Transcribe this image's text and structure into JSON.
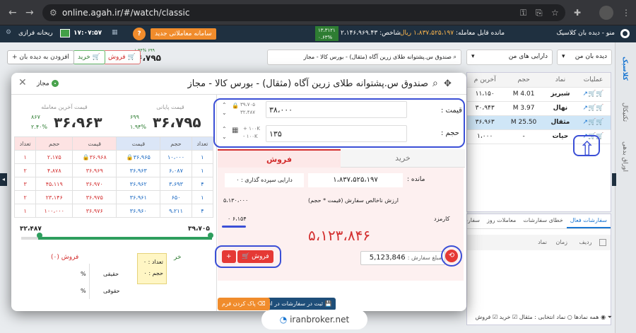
{
  "browser": {
    "url": "online.agah.ir/#/watch/classic"
  },
  "topbar": {
    "logo_label": "منو - دیده بان کلاسیک",
    "purchasable_label": "مانده قابل معامله:",
    "purchasable_value": "۱،۸۳۷،۵۲۵،۱۹۷ ریال",
    "index_label": "شاخص:",
    "index_value": "۲،۱۴۶،۹۶۹.۴۳",
    "index_change": "۱۳،۳۱۲۱",
    "index_pct": "۰.۶۳%",
    "new_system_label": "سامانه معاملاتی جدید",
    "clock": "۱۷:۰۷:۵۷",
    "calc_label": "ریحانه فرازی"
  },
  "watch": {
    "dropdown_watch": "دیده بان من",
    "dropdown_assets": "دارایی های من",
    "search_text": "صندوق س.پشتوانه طلای زرین آگاه (مثقال) - بورس کالا - مجاز",
    "add_label": "افزودن به دیده بان",
    "buy_label": "خرید",
    "sell_label": "فروش",
    "price": "۳۶،۷۹۵",
    "price_change": "۶۹۹",
    "price_pct": "۱.۹۴%",
    "col_ops": "عملیات",
    "col_symbol": "نماد",
    "col_volume": "حجم",
    "col_last": "آخرین م",
    "rows": [
      {
        "symbol": "شبریز",
        "volume": "4.01 M",
        "last": "۱۱،۱۵۰"
      },
      {
        "symbol": "نهال",
        "volume": "3.97 M",
        "last": "۳۰،۹۴۳"
      },
      {
        "symbol": "مثقال",
        "volume": "25.50 M",
        "last": "۳۶،۹۶۳"
      },
      {
        "symbol": "حیات",
        "volume": "-",
        "last": "۱،۰۰۰"
      }
    ]
  },
  "modal": {
    "title": "صندوق س.پشتوانه طلای زرین آگاه (مثقال) - بورس کالا - مجاز",
    "status": "مجاز",
    "closing_label": "قیمت پایانی",
    "closing_price": "۳۶،۷۹۵",
    "closing_change": "۶۹۹",
    "closing_pct": "۱.۹۴%",
    "last_label": "قیمت آخرین معامله",
    "last_price": "۳۶،۹۶۳",
    "last_change": "۸۶۷",
    "last_pct": "۲.۴۰%",
    "ob_headers": [
      "تعداد",
      "حجم",
      "قیمت",
      "قیمت",
      "حجم",
      "تعداد"
    ],
    "ob_rows": [
      [
        "۱",
        "۱۰،۰۰۰",
        "۳۶،۹۶۵",
        "۳۶،۹۶۸",
        "۲،۱۷۵",
        "۱"
      ],
      [
        "۱",
        "۶،۰۸۷",
        "۳۶،۹۶۳",
        "۳۶،۹۶۹",
        "۴،۸۷۸",
        "۲"
      ],
      [
        "۴",
        "۳،۶۹۳",
        "۳۶،۹۶۲",
        "۳۶،۹۷۰",
        "۴۵،۱۱۹",
        "۳"
      ],
      [
        "۱",
        "۶۵۰",
        "۳۶،۹۶۱",
        "۳۶،۹۷۵",
        "۲۳،۱۴۶",
        "۲"
      ],
      [
        "۴",
        "۹،۲۱۱",
        "۳۶،۹۶۰",
        "۳۶،۹۷۶",
        "۱۰۰،۰۰۰",
        "۱"
      ]
    ],
    "range_low": "۳۲،۴۸۷",
    "range_high": "۳۹،۷۰۵",
    "range_fill": 1.0,
    "sell_label": "فروش (۰)",
    "buy_label": "خر",
    "tooltip_count": "تعداد : ۰",
    "tooltip_volume": "حجم : ۰",
    "real_label": "حقیقی",
    "legal_label": "حقوقی",
    "pct": "%",
    "price_label": "قیمت :",
    "price_value": "۳۸،۰۰۰",
    "price_max": "۳۹،۷۰۵",
    "price_min": "۳۲،۴۸۷",
    "volume_label": "حجم :",
    "volume_value": "۱۳۵",
    "vol_plus": "+ ۱۰۰K",
    "vol_minus": "- ۱۰۰K",
    "tab_buy": "خرید",
    "tab_sell": "فروش",
    "remaining_label": "مانده :",
    "remaining_value": "۱،۸۳۷،۵۲۵،۱۹۷",
    "deposit_label": "دارایی سپرده گذاری : ۰",
    "gross_label": "ارزش ناخالص سفارش (قیمت * حجم)",
    "gross_value": "۵،۱۳۰،۰۰۰",
    "fee_label": "کارمزد",
    "fee_value": "۶،۱۵۴",
    "fee_zero": "۰",
    "total": "۵،۱۲۳،۸۴۶",
    "order_amount_label": "مبلغ سفارش :",
    "order_amount": "5,123,846",
    "sell_button": "فروش",
    "plus": "+",
    "clear_button": "پاک کردن فرم",
    "queue_button": "ثبت در سفارشات در انتظار"
  },
  "orders": {
    "tabs": [
      "سفارشات فعال",
      "خطای سفارشات",
      "معاملات روز",
      "سفارشات روز"
    ],
    "col_row": "ردیف",
    "col_time": "زمان",
    "col_symbol": "نماد",
    "filter_all": "همه نمادها",
    "filter_selected": "نماد انتخابی : مثقال",
    "filter_buy": "خرید",
    "filter_sell": "فروش"
  },
  "side": {
    "tabs": [
      "کلاسیک",
      "تکنیکال",
      "اوراق بدهی"
    ]
  },
  "watermark": "iranbroker.net"
}
